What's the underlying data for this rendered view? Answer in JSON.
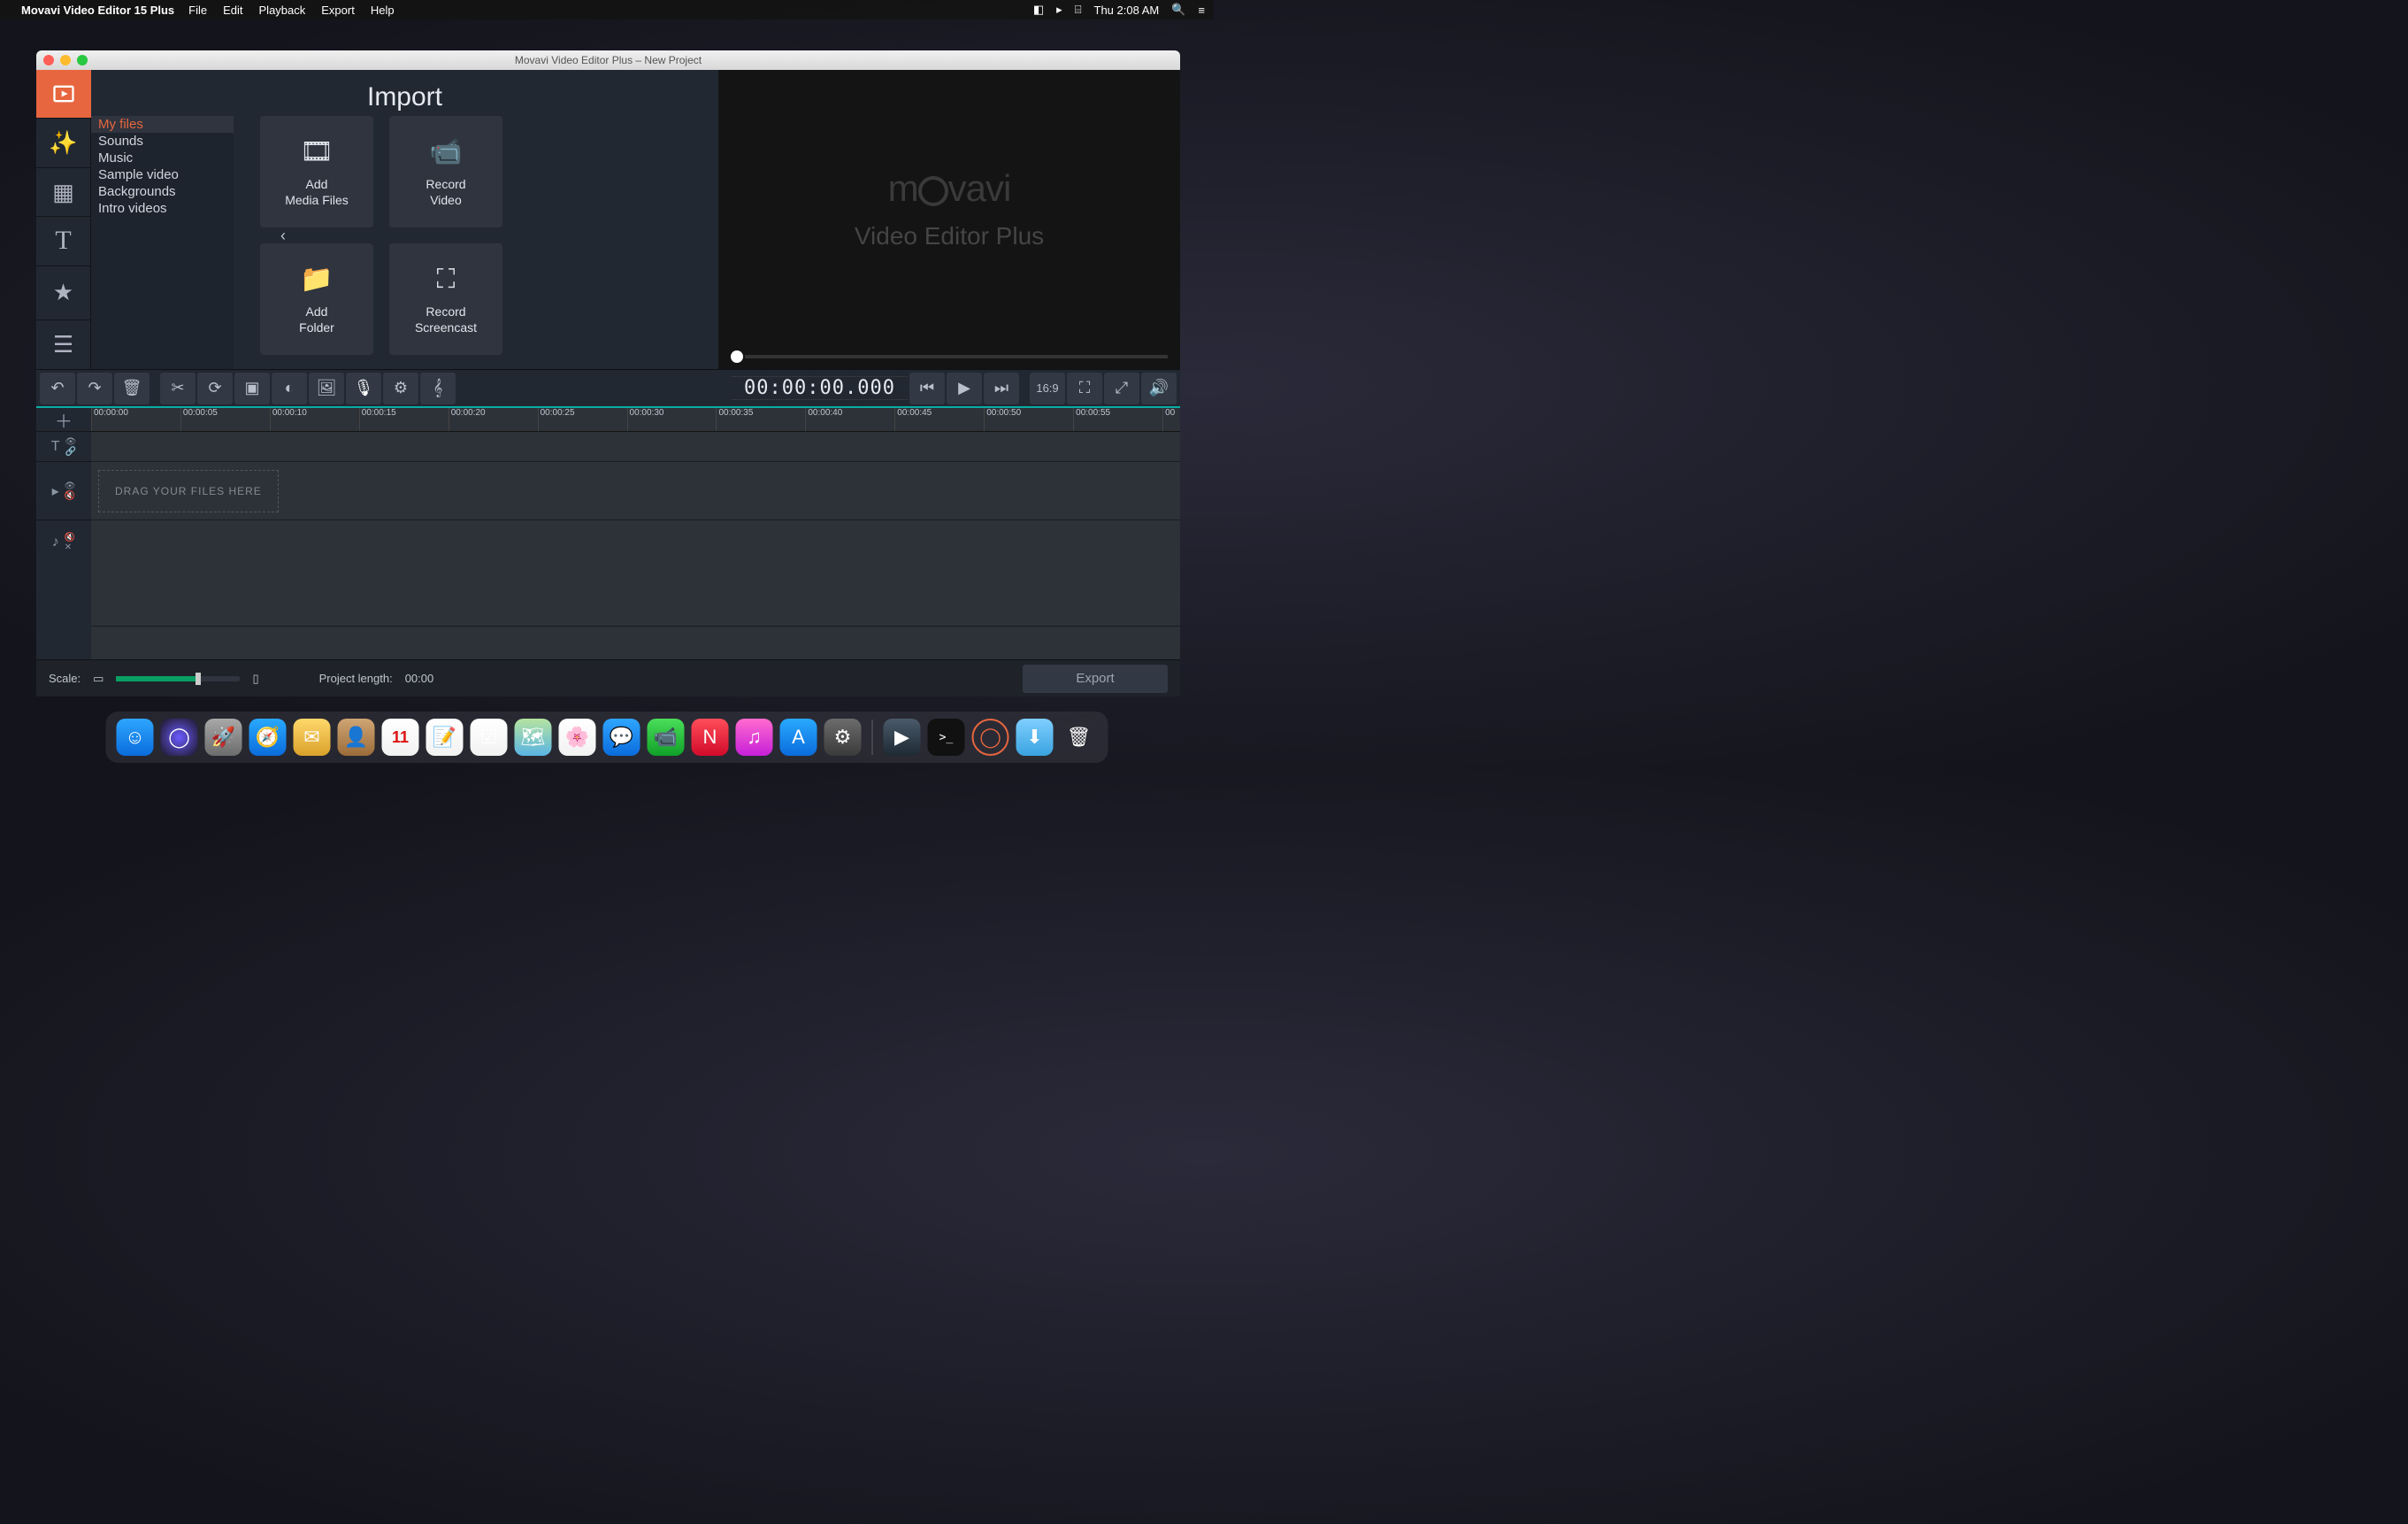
{
  "menubar": {
    "app_name": "Movavi Video Editor 15 Plus",
    "items": [
      "File",
      "Edit",
      "Playback",
      "Export",
      "Help"
    ],
    "clock": "Thu 2:08 AM"
  },
  "window": {
    "title": "Movavi Video Editor Plus – New Project"
  },
  "import": {
    "heading": "Import",
    "sideList": [
      {
        "label": "My files",
        "active": true
      },
      {
        "label": "Sounds",
        "active": false
      },
      {
        "label": "Music",
        "active": false
      },
      {
        "label": "Sample video",
        "active": false
      },
      {
        "label": "Backgrounds",
        "active": false
      },
      {
        "label": "Intro videos",
        "active": false
      }
    ],
    "cards": [
      {
        "label": "Add\nMedia Files",
        "icon": "media"
      },
      {
        "label": "Record\nVideo",
        "icon": "camera"
      },
      {
        "label": "Add\nFolder",
        "icon": "folder"
      },
      {
        "label": "Record\nScreencast",
        "icon": "screen"
      }
    ]
  },
  "preview": {
    "brand": "movavi",
    "sub": "Video Editor Plus"
  },
  "toolbar": {
    "timecode": "00:00:00.000",
    "aspect": "16:9"
  },
  "timeline": {
    "ticks": [
      "00:00:00",
      "00:00:05",
      "00:00:10",
      "00:00:15",
      "00:00:20",
      "00:00:25",
      "00:00:30",
      "00:00:35",
      "00:00:40",
      "00:00:45",
      "00:00:50",
      "00:00:55",
      "00"
    ],
    "drop_hint": "DRAG YOUR FILES HERE"
  },
  "bottom": {
    "scale_label": "Scale:",
    "project_length_label": "Project length:",
    "project_length_value": "00:00",
    "export": "Export"
  },
  "dock": {
    "items": [
      {
        "name": "finder",
        "bg": "linear-gradient(#2fa6ff,#0a6cdc)",
        "glyph": "☺"
      },
      {
        "name": "siri",
        "bg": "radial-gradient(circle,#6b5bff,#1a1520)",
        "glyph": "◯"
      },
      {
        "name": "launchpad",
        "bg": "linear-gradient(#a8a8a8,#6c6c6c)",
        "glyph": "🚀"
      },
      {
        "name": "safari",
        "bg": "linear-gradient(#29a9ff,#0a6cdc)",
        "glyph": "🧭"
      },
      {
        "name": "mail-client",
        "bg": "linear-gradient(#ffd86b,#d9a12a)",
        "glyph": "✉"
      },
      {
        "name": "contacts",
        "bg": "linear-gradient(#cfa574,#9b6c3a)",
        "glyph": "👤"
      },
      {
        "name": "calendar",
        "bg": "linear-gradient(#fff,#f2f2f2)",
        "glyph": "11"
      },
      {
        "name": "notes",
        "bg": "linear-gradient(#fff,#f2f2f2)",
        "glyph": "📝"
      },
      {
        "name": "reminders",
        "bg": "linear-gradient(#fff,#f2f2f2)",
        "glyph": "☑"
      },
      {
        "name": "maps",
        "bg": "linear-gradient(#b5e3a0,#5ab5e3)",
        "glyph": "🗺"
      },
      {
        "name": "photos",
        "bg": "linear-gradient(#fff,#f2f2f2)",
        "glyph": "🌸"
      },
      {
        "name": "messages",
        "bg": "linear-gradient(#2fa6ff,#0a6cdc)",
        "glyph": "💬"
      },
      {
        "name": "facetime",
        "bg": "linear-gradient(#4ade5a,#10a028)",
        "glyph": "📹"
      },
      {
        "name": "news",
        "bg": "linear-gradient(#ff4d5a,#d10b2a)",
        "glyph": "N"
      },
      {
        "name": "itunes",
        "bg": "linear-gradient(#ff6bcf,#c71fd8)",
        "glyph": "♫"
      },
      {
        "name": "appstore",
        "bg": "linear-gradient(#29a9ff,#0a6cdc)",
        "glyph": "A"
      },
      {
        "name": "preferences",
        "bg": "linear-gradient(#6c6c6c,#3a3a3a)",
        "glyph": "⚙"
      }
    ],
    "right": [
      {
        "name": "quicktime",
        "bg": "linear-gradient(#4a5a6a,#1e2a34)",
        "glyph": "▶"
      },
      {
        "name": "terminal",
        "bg": "#111",
        "glyph": ">_"
      },
      {
        "name": "movavi",
        "bg": "transparent",
        "glyph": "◯"
      },
      {
        "name": "downloads",
        "bg": "linear-gradient(#7fcfff,#3aa3e0)",
        "glyph": "⬇"
      },
      {
        "name": "trash",
        "bg": "transparent",
        "glyph": "🗑"
      }
    ]
  }
}
